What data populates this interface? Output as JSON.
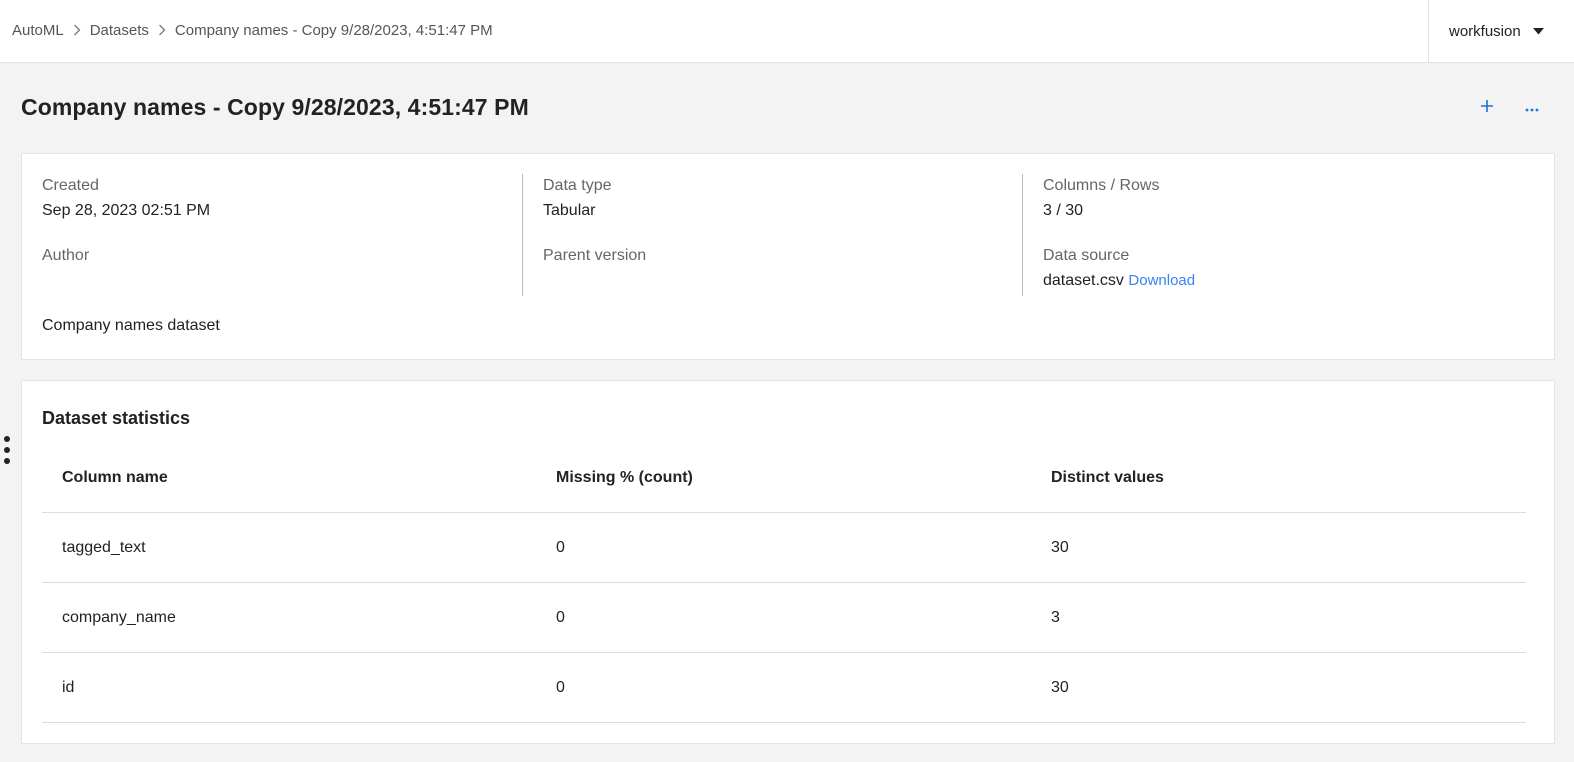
{
  "breadcrumb": {
    "root": "AutoML",
    "section": "Datasets",
    "current": "Company names - Copy 9/28/2023, 4:51:47 PM"
  },
  "tenant": {
    "name": "workfusion"
  },
  "page": {
    "title": "Company names - Copy 9/28/2023, 4:51:47 PM"
  },
  "info": {
    "created_label": "Created",
    "created_value": "Sep 28, 2023 02:51 PM",
    "author_label": "Author",
    "author_value": "",
    "data_type_label": "Data type",
    "data_type_value": "Tabular",
    "parent_version_label": "Parent version",
    "parent_version_value": "",
    "columns_rows_label": "Columns / Rows",
    "columns_rows_value": "3 / 30",
    "data_source_label": "Data source",
    "data_source_file": "dataset.csv",
    "download_label": "Download",
    "description": "Company names dataset"
  },
  "stats": {
    "title": "Dataset statistics",
    "headers": [
      "Column name",
      "Missing % (count)",
      "Distinct values"
    ],
    "rows": [
      [
        "tagged_text",
        "0",
        "30"
      ],
      [
        "company_name",
        "0",
        "3"
      ],
      [
        "id",
        "0",
        "30"
      ]
    ]
  },
  "colors": {
    "accent": "#1f6fd8",
    "link": "#3b82f6",
    "background": "#f3f3f3"
  }
}
